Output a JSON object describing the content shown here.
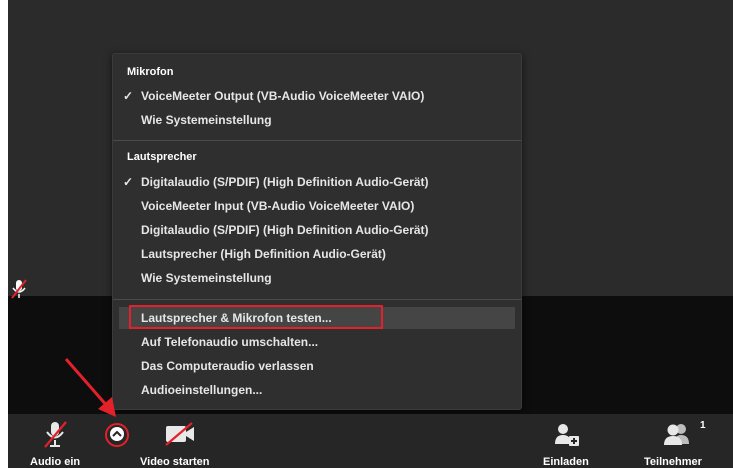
{
  "menu": {
    "mikrofon_header": "Mikrofon",
    "mikrofon_items": [
      {
        "label": "VoiceMeeter Output (VB-Audio VoiceMeeter VAIO)",
        "checked": true
      },
      {
        "label": "Wie Systemeinstellung",
        "checked": false
      }
    ],
    "lautsprecher_header": "Lautsprecher",
    "lautsprecher_items": [
      {
        "label": "Digitalaudio (S/PDIF) (High Definition Audio-Gerät)",
        "checked": true
      },
      {
        "label": "VoiceMeeter Input (VB-Audio VoiceMeeter VAIO)",
        "checked": false
      },
      {
        "label": "Digitalaudio (S/PDIF) (High Definition Audio-Gerät)",
        "checked": false
      },
      {
        "label": "Lautsprecher (High Definition Audio-Gerät)",
        "checked": false
      },
      {
        "label": "Wie Systemeinstellung",
        "checked": false
      }
    ],
    "actions": [
      {
        "label": "Lautsprecher & Mikrofon testen...",
        "highlighted": true
      },
      {
        "label": "Auf Telefonaudio umschalten...",
        "highlighted": false
      },
      {
        "label": "Das Computeraudio verlassen",
        "highlighted": false
      },
      {
        "label": "Audioeinstellungen...",
        "highlighted": false
      }
    ],
    "check_glyph": "✓"
  },
  "toolbar": {
    "audio_label": "Audio ein",
    "video_label": "Video starten",
    "invite_label": "Einladen",
    "participants_label": "Teilnehmer",
    "participants_count": "1"
  },
  "colors": {
    "accent_red": "#e3212b",
    "menu_bg": "#2f2f2f",
    "toolbar_bg": "#262626",
    "video_bg": "#2b2b2b"
  },
  "icons": {
    "audio": "muted-mic-icon",
    "chevron": "chevron-up-icon",
    "video": "video-off-icon",
    "invite": "add-user-icon",
    "participants": "participants-icon",
    "annotation": "red-arrow-icon"
  }
}
